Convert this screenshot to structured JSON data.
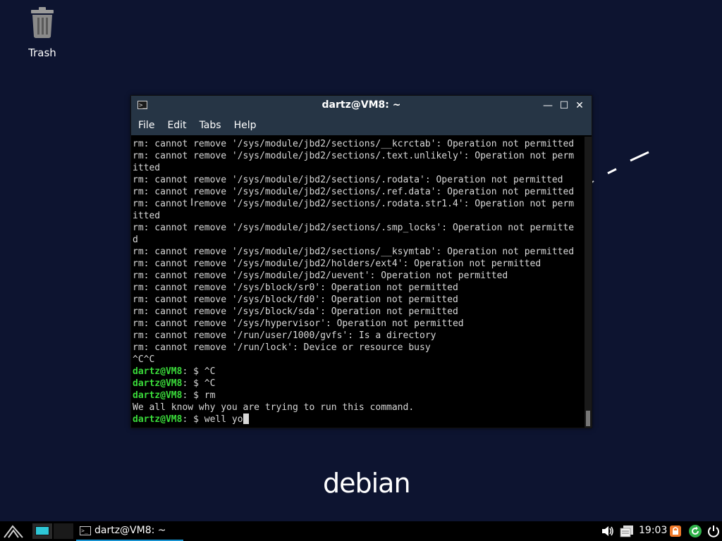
{
  "desktop": {
    "trash_label": "Trash",
    "wallpaper_text": "debian"
  },
  "window": {
    "title": "dartz@VM8: ~",
    "controls": {
      "minimize": "—",
      "maximize": "☐",
      "close": "✕"
    },
    "menu": [
      "File",
      "Edit",
      "Tabs",
      "Help"
    ]
  },
  "terminal": {
    "lines": [
      "rm: cannot remove '/sys/module/jbd2/sections/__kcrctab': Operation not permitted",
      "rm: cannot remove '/sys/module/jbd2/sections/.text.unlikely': Operation not perm",
      "itted",
      "rm: cannot remove '/sys/module/jbd2/sections/.rodata': Operation not permitted",
      "rm: cannot remove '/sys/module/jbd2/sections/.ref.data': Operation not permitted",
      "rm: cannot remove '/sys/module/jbd2/sections/.rodata.str1.4': Operation not perm",
      "itted",
      "rm: cannot remove '/sys/module/jbd2/sections/.smp_locks': Operation not permitte",
      "d",
      "rm: cannot remove '/sys/module/jbd2/sections/__ksymtab': Operation not permitted",
      "rm: cannot remove '/sys/module/jbd2/holders/ext4': Operation not permitted",
      "rm: cannot remove '/sys/module/jbd2/uevent': Operation not permitted",
      "rm: cannot remove '/sys/block/sr0': Operation not permitted",
      "rm: cannot remove '/sys/block/fd0': Operation not permitted",
      "rm: cannot remove '/sys/block/sda': Operation not permitted",
      "rm: cannot remove '/sys/hypervisor': Operation not permitted",
      "rm: cannot remove '/run/user/1000/gvfs': Is a directory",
      "rm: cannot remove '/run/lock': Device or resource busy",
      "^C^C"
    ],
    "prompt_user": "dartz@VM8",
    "prompt_suffix": ": $ ",
    "commands": [
      "^C",
      "^C",
      "rm"
    ],
    "message": "We all know why you are trying to run this command.",
    "current_input": "well yo"
  },
  "taskbar": {
    "task_label": "dartz@VM8: ~",
    "clock": "19:03",
    "accent": "#1793d1"
  },
  "colors": {
    "desktop_bg": "#0d1430",
    "titlebar_bg": "#263545",
    "prompt_green": "#3adb3a"
  }
}
